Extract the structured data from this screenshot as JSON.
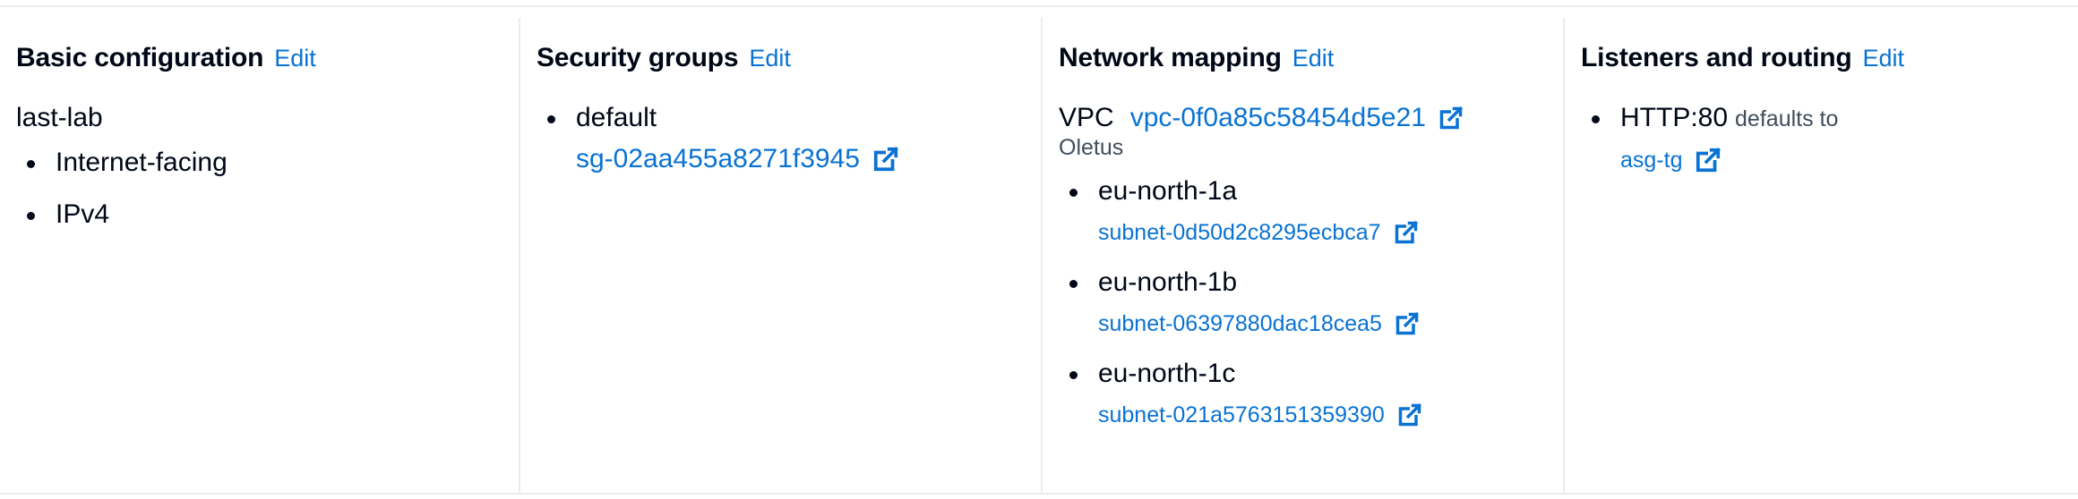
{
  "sections": {
    "basic": {
      "title": "Basic configuration",
      "edit": "Edit",
      "name": "last-lab",
      "items": [
        "Internet-facing",
        "IPv4"
      ]
    },
    "security": {
      "title": "Security groups",
      "edit": "Edit",
      "group_name": "default",
      "group_id": "sg-02aa455a8271f3945"
    },
    "network": {
      "title": "Network mapping",
      "edit": "Edit",
      "vpc_label": "VPC",
      "vpc_id": "vpc-0f0a85c58454d5e21",
      "vpc_note": "Oletus",
      "zones": [
        {
          "name": "eu-north-1a",
          "subnet": "subnet-0d50d2c8295ecbca7"
        },
        {
          "name": "eu-north-1b",
          "subnet": "subnet-06397880dac18cea5"
        },
        {
          "name": "eu-north-1c",
          "subnet": "subnet-021a5763151359390"
        }
      ]
    },
    "listeners": {
      "title": "Listeners and routing",
      "edit": "Edit",
      "listener": "HTTP:80",
      "defaults_text": "defaults to",
      "target_group": "asg-tg"
    }
  },
  "icons": {
    "external_link": "external-link-icon"
  },
  "colors": {
    "link": "#0972d3",
    "text": "#000716",
    "muted": "#414d5c",
    "divider": "#e9ebed"
  }
}
